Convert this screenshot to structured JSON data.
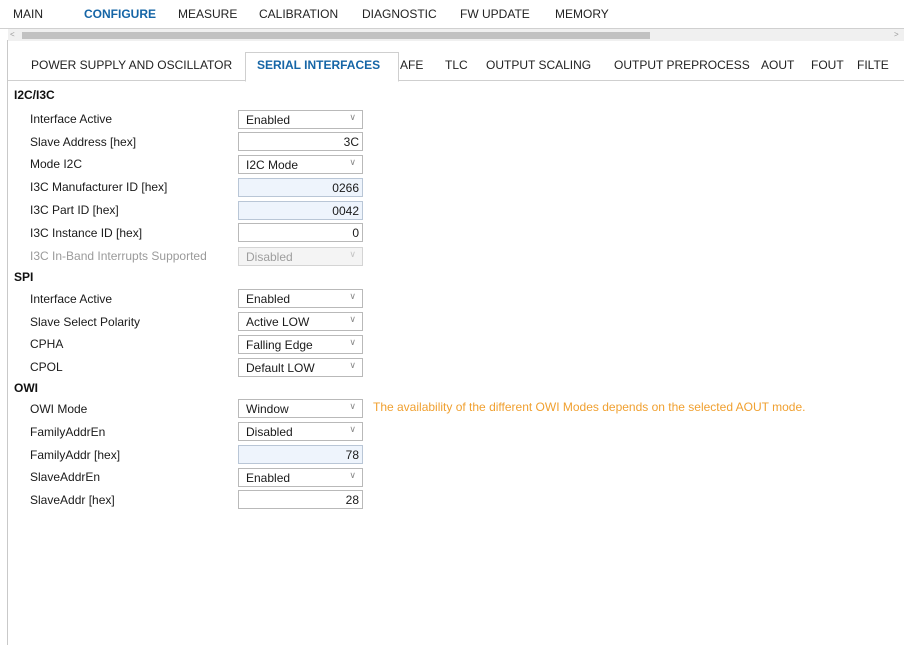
{
  "top_tabs": [
    "MAIN",
    "CONFIGURE",
    "MEASURE",
    "CALIBRATION",
    "DIAGNOSTIC",
    "FW UPDATE",
    "MEMORY"
  ],
  "active_top_tab": "CONFIGURE",
  "sub_tabs": [
    "POWER SUPPLY AND OSCILLATOR",
    "SERIAL INTERFACES",
    "AFE",
    "TLC",
    "OUTPUT SCALING",
    "OUTPUT PREPROCESS",
    "AOUT",
    "FOUT",
    "FILTE"
  ],
  "active_sub_tab": "SERIAL INTERFACES",
  "scroll": {
    "left_arrow": "<",
    "right_arrow": ">"
  },
  "sections": {
    "i2c": {
      "title": "I2C/I3C",
      "rows": [
        {
          "label": "Interface Active",
          "value": "Enabled"
        },
        {
          "label": "Slave Address [hex]",
          "value": "3C"
        },
        {
          "label": "Mode I2C",
          "value": "I2C Mode"
        },
        {
          "label": "I3C Manufacturer ID [hex]",
          "value": "0266"
        },
        {
          "label": "I3C Part ID [hex]",
          "value": "0042"
        },
        {
          "label": "I3C Instance ID [hex]",
          "value": "0"
        },
        {
          "label": "I3C In-Band Interrupts Supported",
          "value": "Disabled"
        }
      ]
    },
    "spi": {
      "title": "SPI",
      "rows": [
        {
          "label": "Interface Active",
          "value": "Enabled"
        },
        {
          "label": "Slave Select Polarity",
          "value": "Active LOW"
        },
        {
          "label": "CPHA",
          "value": "Falling Edge"
        },
        {
          "label": "CPOL",
          "value": "Default LOW"
        }
      ]
    },
    "owi": {
      "title": "OWI",
      "rows": [
        {
          "label": "OWI Mode",
          "value": "Window"
        },
        {
          "label": "FamilyAddrEn",
          "value": "Disabled"
        },
        {
          "label": "FamilyAddr [hex]",
          "value": "78"
        },
        {
          "label": "SlaveAddrEn",
          "value": "Enabled"
        },
        {
          "label": "SlaveAddr [hex]",
          "value": "28"
        }
      ],
      "note": "The availability of the different OWI Modes depends on the selected AOUT mode."
    }
  },
  "icons": {
    "dropdown": "chevron-down-icon"
  },
  "colors": {
    "active_tab": "#1565a6",
    "note": "#f0a030",
    "readonly_field": "#eef4fc"
  }
}
